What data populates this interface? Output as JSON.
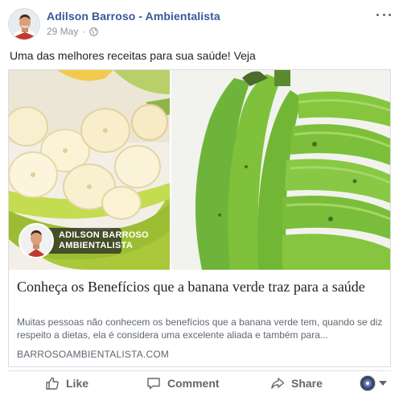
{
  "post": {
    "author": "Adilson Barroso - Ambientalista",
    "date": "29 May",
    "separator": "·",
    "audience_icon": "globe-icon",
    "text": "Uma das melhores receitas para sua saúde! Veja"
  },
  "link_card": {
    "title": "Conheça os Benefícios que a banana verde traz para a saúde",
    "description": "Muitas pessoas não conhecem os benefícios que a banana verde tem, quando se diz respeito a dietas, ela é considera uma excelente aliada e também para...",
    "domain": "BARROSOAMBIENTALISTA.COM",
    "image_overlay": {
      "line1": "ADILSON BARROSO",
      "line2": "AMBIENTALISTA"
    }
  },
  "actions": {
    "like": "Like",
    "comment": "Comment",
    "share": "Share"
  },
  "colors": {
    "author_link": "#385898",
    "muted_text": "#606770",
    "banana_green": "#7fc13a",
    "bowl_green": "#b7d33a"
  }
}
